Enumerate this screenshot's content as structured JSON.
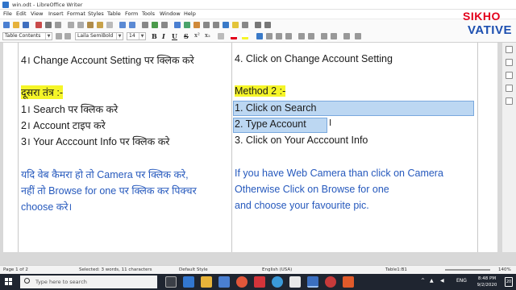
{
  "window": {
    "title": "win.odt - LibreOffice Writer"
  },
  "menubar": {
    "items": [
      "File",
      "Edit",
      "View",
      "Insert",
      "Format",
      "Styles",
      "Table",
      "Form",
      "Tools",
      "Window",
      "Help"
    ]
  },
  "toolbar": {
    "paragraph_style": "Table Contents",
    "font_name": "Laila SemiBold",
    "font_size": "14",
    "bold": "B",
    "italic": "I",
    "underline": "U",
    "strike": "S",
    "superscript": "x²",
    "subscript": "x₂",
    "highlight_color": "#f5f528",
    "font_color": "#e3001b"
  },
  "brand": {
    "line1": "SIKHO",
    "line2": "VATIVE",
    "line1_color": "#e3001b",
    "line2_color": "#1c4fb0"
  },
  "document": {
    "left": {
      "line1": "4। Change Account Setting पर क्लिक करे",
      "heading": "दूसरा तंत्र :-",
      "item1": "1। Search पर क्लिक करे",
      "item2": "2। Account टाइप करे",
      "item3": "3। Your Acccount Info पर क्लिक करे",
      "para1": "यदि वेब कैमरा हो तो Camera पर क्लिक करे,",
      "para2": "नहीं तो Browse for one पर क्लिक कर पिक्चर",
      "para3": "choose करे।"
    },
    "right": {
      "line1": "4. Click on Change Account Setting",
      "heading": "Method 2 :-",
      "item1": "1. Click on Search",
      "item2": "2. Type Account",
      "item3": "3. Click on Your Acccount Info",
      "para1": "If you have Web Camera than click on Camera",
      "para2": "Otherwise Click on Browse for one",
      "para3": "and choose your favourite pic."
    }
  },
  "statusbar": {
    "page": "Page 1 of 2",
    "selection": "Selected: 3 words, 11 characters",
    "page_style": "Default Style",
    "language": "English (USA)",
    "table_cell": "Table1:B1",
    "zoom": "140%"
  },
  "taskbar": {
    "search_placeholder": "Type here to search",
    "language": "ENG",
    "time": "8:48 PM",
    "date": "9/2/2020",
    "notification_count": "20"
  }
}
